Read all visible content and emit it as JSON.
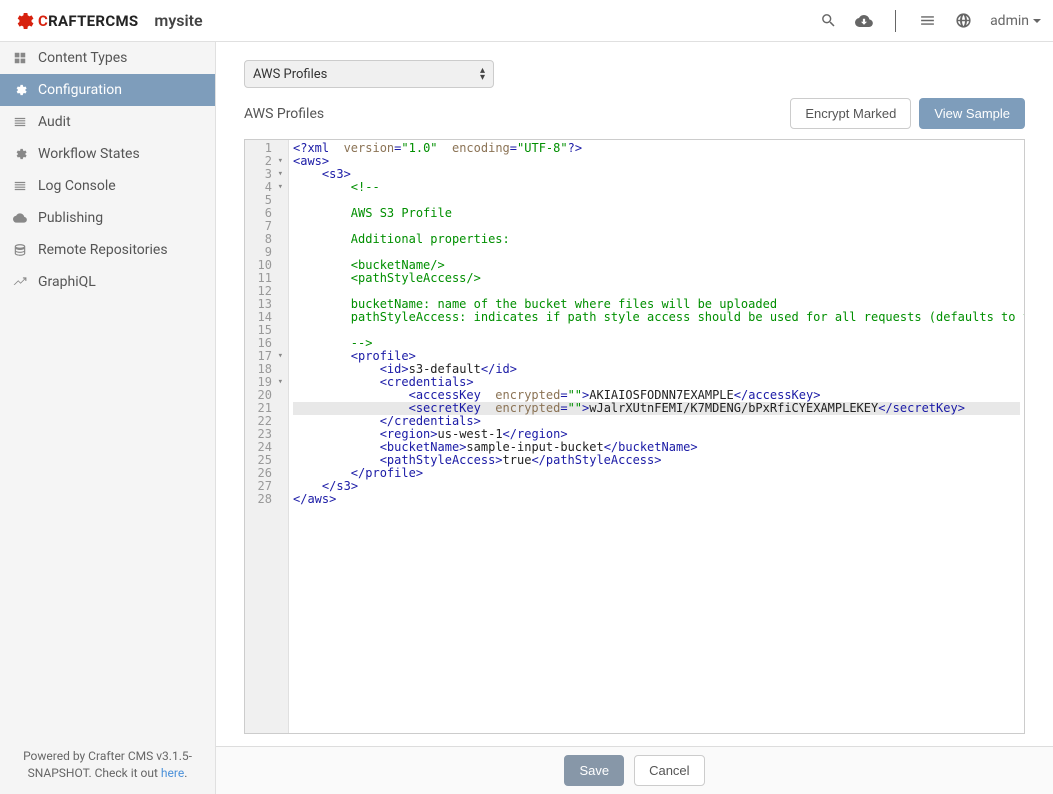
{
  "header": {
    "logo_c": "C",
    "logo_rest": "RAFTERCMS",
    "site_name": "mysite",
    "user": "admin"
  },
  "sidebar": {
    "items": [
      {
        "label": "Content Types"
      },
      {
        "label": "Configuration"
      },
      {
        "label": "Audit"
      },
      {
        "label": "Workflow States"
      },
      {
        "label": "Log Console"
      },
      {
        "label": "Publishing"
      },
      {
        "label": "Remote Repositories"
      },
      {
        "label": "GraphiQL"
      }
    ],
    "footer_prefix": "Powered by Crafter CMS v3.1.5-SNAPSHOT. Check it out ",
    "footer_link": "here",
    "footer_suffix": "."
  },
  "main": {
    "dropdown": "AWS Profiles",
    "section_title": "AWS Profiles",
    "buttons": {
      "encrypt": "Encrypt Marked",
      "view_sample": "View Sample"
    }
  },
  "chart_data": {
    "type": "table",
    "description": "XML source code displayed in code editor",
    "lines": [
      {
        "n": 1,
        "fold": false,
        "raw": "<?xml version=\"1.0\" encoding=\"UTF-8\"?>"
      },
      {
        "n": 2,
        "fold": true,
        "raw": "<aws>"
      },
      {
        "n": 3,
        "fold": true,
        "raw": "    <s3>"
      },
      {
        "n": 4,
        "fold": true,
        "raw": "        <!--"
      },
      {
        "n": 5,
        "fold": false,
        "raw": ""
      },
      {
        "n": 6,
        "fold": false,
        "raw": "        AWS S3 Profile"
      },
      {
        "n": 7,
        "fold": false,
        "raw": ""
      },
      {
        "n": 8,
        "fold": false,
        "raw": "        Additional properties:"
      },
      {
        "n": 9,
        "fold": false,
        "raw": ""
      },
      {
        "n": 10,
        "fold": false,
        "raw": "        <bucketName/>"
      },
      {
        "n": 11,
        "fold": false,
        "raw": "        <pathStyleAccess/>"
      },
      {
        "n": 12,
        "fold": false,
        "raw": ""
      },
      {
        "n": 13,
        "fold": false,
        "raw": "        bucketName: name of the bucket where files will be uploaded"
      },
      {
        "n": 14,
        "fold": false,
        "raw": "        pathStyleAccess: indicates if path style access should be used for all requests (defaults to false)"
      },
      {
        "n": 15,
        "fold": false,
        "raw": ""
      },
      {
        "n": 16,
        "fold": false,
        "raw": "        -->"
      },
      {
        "n": 17,
        "fold": true,
        "raw": "        <profile>"
      },
      {
        "n": 18,
        "fold": false,
        "raw": "            <id>s3-default</id>"
      },
      {
        "n": 19,
        "fold": true,
        "raw": "            <credentials>"
      },
      {
        "n": 20,
        "fold": false,
        "raw": "                <accessKey encrypted=\"\">AKIAIOSFODNN7EXAMPLE</accessKey>"
      },
      {
        "n": 21,
        "fold": false,
        "raw": "                <secretKey encrypted=\"\">wJalrXUtnFEMI/K7MDENG/bPxRfiCYEXAMPLEKEY</secretKey>"
      },
      {
        "n": 22,
        "fold": false,
        "raw": "            </credentials>"
      },
      {
        "n": 23,
        "fold": false,
        "raw": "            <region>us-west-1</region>"
      },
      {
        "n": 24,
        "fold": false,
        "raw": "            <bucketName>sample-input-bucket</bucketName>"
      },
      {
        "n": 25,
        "fold": false,
        "raw": "            <pathStyleAccess>true</pathStyleAccess>"
      },
      {
        "n": 26,
        "fold": false,
        "raw": "        </profile>"
      },
      {
        "n": 27,
        "fold": false,
        "raw": "    </s3>"
      },
      {
        "n": 28,
        "fold": false,
        "raw": "</aws>"
      }
    ],
    "highlighted_line": 21
  },
  "bottom": {
    "save": "Save",
    "cancel": "Cancel"
  }
}
